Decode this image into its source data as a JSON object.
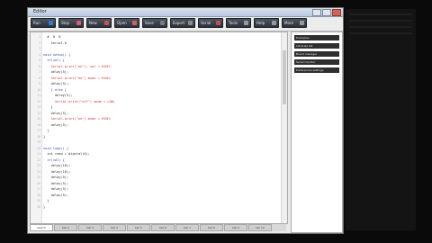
{
  "window": {
    "title": "Editor"
  },
  "toolbar": {
    "buttons": [
      {
        "label": "Run",
        "color": "#2f7fd1"
      },
      {
        "label": "Stop",
        "color": "#d85b7b"
      },
      {
        "label": "New",
        "color": "#c94f4f"
      },
      {
        "label": "Open",
        "color": "#d35f5f"
      },
      {
        "label": "Save",
        "color": "#7a7a7a"
      },
      {
        "label": "Export",
        "color": "#8a8a8a"
      },
      {
        "label": "Serial",
        "color": "#c04f4f"
      },
      {
        "label": "Tools",
        "color": "#9a9a9a"
      },
      {
        "label": "Help",
        "color": "#9a9a9a"
      },
      {
        "label": "More",
        "color": "#9a9a9a"
      }
    ]
  },
  "editor": {
    "lines": [
      {
        "n": "1",
        "text": "  #  0  0"
      },
      {
        "n": "2",
        "text": "    Serial.b"
      },
      {
        "n": "3",
        "text": ""
      },
      {
        "n": "4",
        "text": "void setup() {"
      },
      {
        "n": "5",
        "text": "  if(val) {"
      },
      {
        "n": "6",
        "text": "    Serial.print(\"on\"); val = HIGH;"
      },
      {
        "n": "7",
        "text": "    delay(5);"
      },
      {
        "n": "8",
        "text": "    Serial.print(\"on\") mode = HIGH;"
      },
      {
        "n": "9",
        "text": "    delay(5);"
      },
      {
        "n": "10",
        "text": "    } else {"
      },
      {
        "n": "11",
        "text": "      delay(5);"
      },
      {
        "n": "12",
        "text": "      Serial.print(\"off\") mode = LOW;"
      },
      {
        "n": "13",
        "text": "    }"
      },
      {
        "n": "14",
        "text": "    delay(5);"
      },
      {
        "n": "15",
        "text": "    Serial.print(\"on\") mode = HIGH;"
      },
      {
        "n": "16",
        "text": "    delay(5);"
      },
      {
        "n": "17",
        "text": "  }"
      },
      {
        "n": "18",
        "text": "}"
      },
      {
        "n": "19",
        "text": ""
      },
      {
        "n": "20",
        "text": "void loop() {"
      },
      {
        "n": "21",
        "text": "  int read = digital(0);"
      },
      {
        "n": "22",
        "text": "  if(val) {"
      },
      {
        "n": "23",
        "text": "    delay(10);"
      },
      {
        "n": "24",
        "text": "    delay(10);"
      },
      {
        "n": "25",
        "text": "    delay(5);"
      },
      {
        "n": "26",
        "text": "    delay(5);"
      },
      {
        "n": "27",
        "text": "    delay(5);"
      },
      {
        "n": "28",
        "text": "    delay(5);"
      },
      {
        "n": "29",
        "text": "  }"
      },
      {
        "n": "30",
        "text": "}"
      }
    ]
  },
  "tabs": [
    "sketch",
    "tab 2",
    "tab 3",
    "tab 4",
    "tab 5",
    "tab 6",
    "tab 7",
    "tab 8",
    "tab 9",
    "tab 10"
  ],
  "sidepanel": {
    "items": [
      "Examples",
      "Libraries list",
      "Board manager",
      "Serial monitor",
      "Preferences settings"
    ]
  }
}
